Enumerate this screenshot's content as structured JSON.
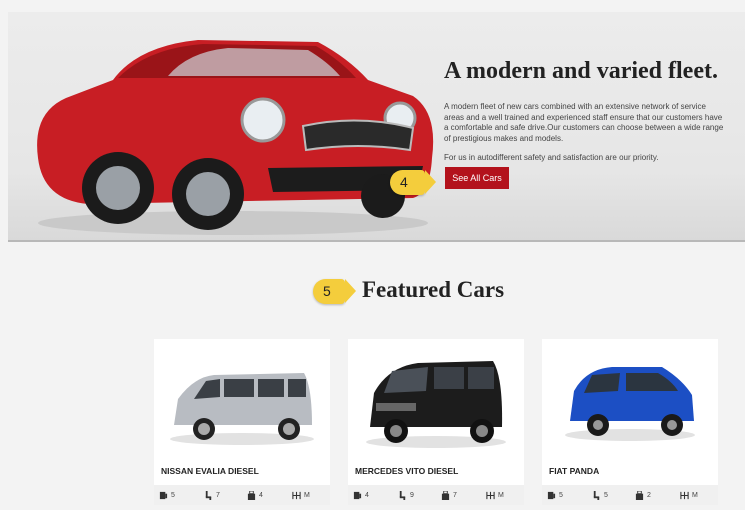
{
  "hero": {
    "title": "A modern and varied fleet.",
    "paragraph": "A modern fleet of new cars combined with an extensive network of service areas and a well trained and experienced staff ensure that our customers have a comfortable and safe drive.Our customers can choose between a wide range of prestigious makes and models.",
    "paragraph2": "For us in autodifferent  safety and satisfaction are our priority.",
    "button_label": "See All Cars",
    "button_color": "#b3121c",
    "marker": "4"
  },
  "featured": {
    "title": "Featured Cars",
    "marker": "5"
  },
  "cars": [
    {
      "name": "NISSAN EVALIA DIESEL",
      "color": "#b8bcc2",
      "specs": {
        "fuel": "5",
        "seats": "7",
        "luggage": "4",
        "transmission": "M"
      }
    },
    {
      "name": "MERCEDES VITO DIESEL",
      "color": "#1c1c1c",
      "specs": {
        "fuel": "4",
        "seats": "9",
        "luggage": "7",
        "transmission": "M"
      }
    },
    {
      "name": "FIAT PANDA",
      "color": "#1c4fc4",
      "specs": {
        "fuel": "5",
        "seats": "5",
        "luggage": "2",
        "transmission": "M"
      }
    }
  ],
  "icons": [
    "fuel-icon",
    "seat-icon",
    "luggage-icon",
    "gearbox-icon"
  ],
  "marker_color": "#f4cd3c"
}
